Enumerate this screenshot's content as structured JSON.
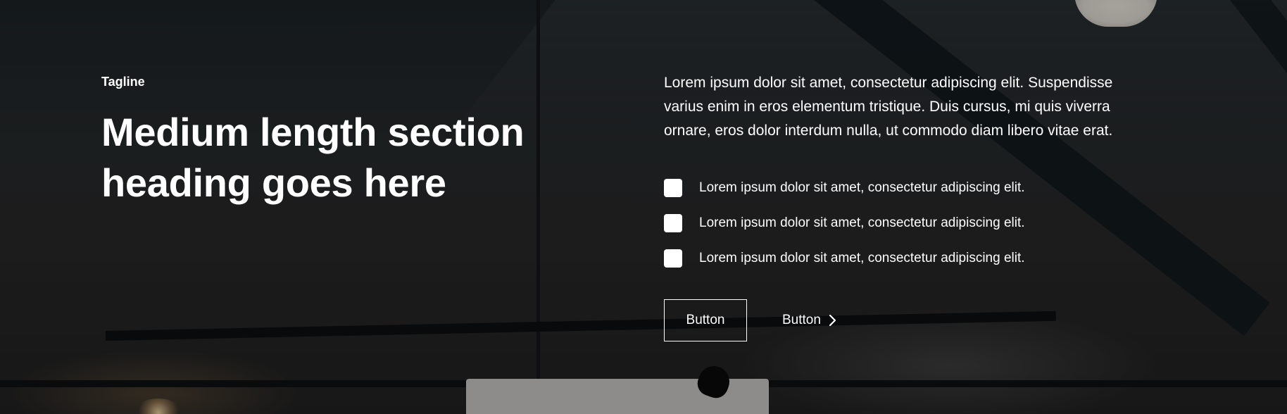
{
  "hero": {
    "tagline": "Tagline",
    "heading_line1": "Medium length section",
    "heading_line2": "heading goes here",
    "description": "Lorem ipsum dolor sit amet, consectetur adipiscing elit. Suspendisse varius enim in eros elementum tristique. Duis cursus, mi quis viverra ornare, eros dolor interdum nulla, ut commodo diam libero vitae erat.",
    "list_items": [
      {
        "icon": "checkbox-icon",
        "label": "Lorem ipsum dolor sit amet, consectetur adipiscing elit."
      },
      {
        "icon": "checkbox-icon",
        "label": "Lorem ipsum dolor sit amet, consectetur adipiscing elit."
      },
      {
        "icon": "checkbox-icon",
        "label": "Lorem ipsum dolor sit amet, consectetur adipiscing elit."
      }
    ],
    "primary_button_label": "Button",
    "secondary_button_label": "Button",
    "secondary_button_icon": "chevron-right-icon"
  },
  "colors": {
    "text": "#ffffff",
    "overlay": "rgba(0,0,0,0.35)"
  }
}
